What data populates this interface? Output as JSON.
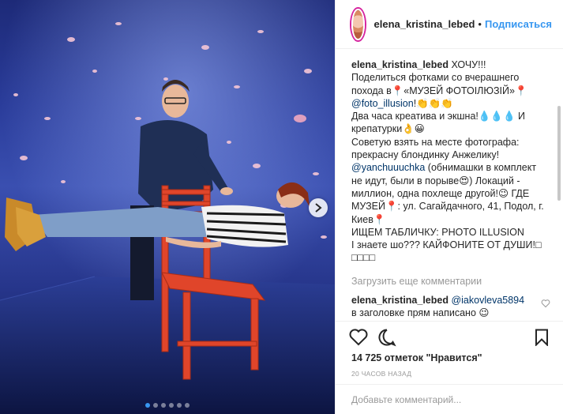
{
  "header": {
    "username": "elena_kristina_lebed",
    "separator": "•",
    "follow_label": "Подписаться"
  },
  "caption": {
    "username": "elena_kristina_lebed",
    "lines": [
      "ХОЧУ!!!",
      "Поделиться фотками со вчерашнего",
      "похода в📍«МУЗЕЙ ФОТОІЛЮЗІЙ»📍",
      "@foto_illusion!👏👏👏",
      "Два часа креатива и экшна!💧💧💧 И",
      "крепатурки👌😀",
      "Советую взять на месте фотографа:",
      "прекрасну блондинку Анжелику!",
      "@yanchuuuchka (обнимашки в комплект",
      "не идут, были в порыве😍) Локаций -",
      "миллион, одна похлеще другой!😉 ГДЕ",
      "МУЗЕЙ📍: ул. Сагайдачного, 41, Подол, г.",
      "Киев📍",
      "ИЩЕМ ТАБЛИЧКУ: PHOTO ILLUSION",
      "І знаете шо??? КАЙФОНИТЕ ОТ ДУШИ!□",
      "□□□□"
    ],
    "mention_1": "@foto_illusion",
    "mention_2": "@yanchuuuchka"
  },
  "load_more_label": "Загрузить еще комментарии",
  "comment": {
    "username": "elena_kristina_lebed",
    "mention": "@iakovleva5894",
    "text": "в заголовке прям написано 😉"
  },
  "actions": {
    "like_icon": "heart-icon",
    "comment_icon": "comment-icon",
    "share_icon": "share-icon",
    "save_icon": "bookmark-icon"
  },
  "likes_text": "14 725 отметок \"Нравится\"",
  "time_text": "20 ЧАСОВ НАЗАД",
  "add_comment_placeholder": "Добавьте комментарий...",
  "carousel": {
    "count": 6,
    "active": 0
  },
  "colors": {
    "link_blue": "#3897f0",
    "mention_blue": "#003569",
    "muted": "#999999",
    "chair_red": "#e0452a"
  }
}
